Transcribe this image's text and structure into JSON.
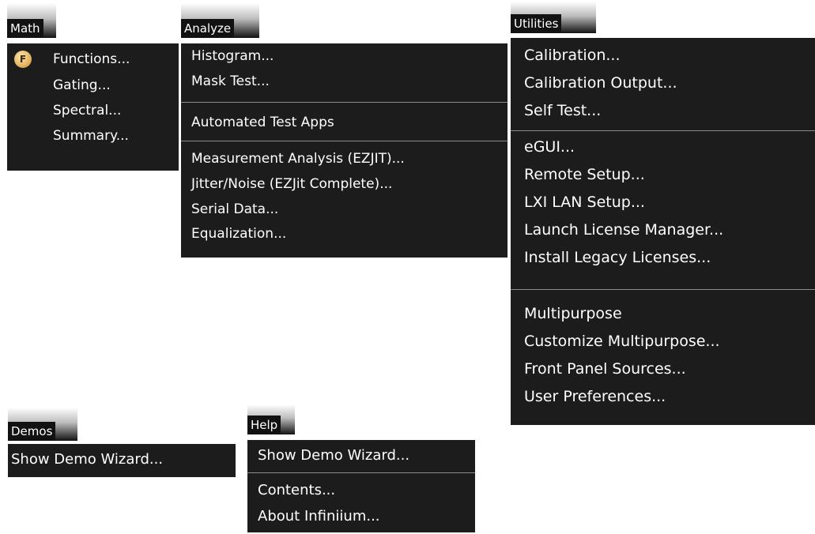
{
  "menus": {
    "math": {
      "title": "Math",
      "items": [
        {
          "label": "Functions...",
          "icon": "functions-f-icon"
        },
        {
          "label": "Gating..."
        },
        {
          "label": "Spectral..."
        },
        {
          "label": "Summary..."
        }
      ]
    },
    "analyze": {
      "title": "Analyze",
      "items": [
        {
          "label": "Histogram..."
        },
        {
          "label": "Mask Test..."
        },
        {
          "label": "Automated Test Apps"
        },
        {
          "label": "Measurement Analysis (EZJIT)..."
        },
        {
          "label": "Jitter/Noise (EZJit Complete)..."
        },
        {
          "label": "Serial Data..."
        },
        {
          "label": "Equalization..."
        }
      ]
    },
    "utilities": {
      "title": "Utilities",
      "items": [
        {
          "label": "Calibration..."
        },
        {
          "label": "Calibration Output..."
        },
        {
          "label": "Self Test..."
        },
        {
          "label": "eGUI..."
        },
        {
          "label": "Remote Setup..."
        },
        {
          "label": "LXI LAN Setup..."
        },
        {
          "label": "Launch License Manager..."
        },
        {
          "label": "Install Legacy Licenses..."
        },
        {
          "label": "Multipurpose"
        },
        {
          "label": "Customize Multipurpose..."
        },
        {
          "label": "Front Panel Sources..."
        },
        {
          "label": "User Preferences..."
        }
      ]
    },
    "demos": {
      "title": "Demos",
      "items": [
        {
          "label": "Show Demo Wizard..."
        }
      ]
    },
    "help": {
      "title": "Help",
      "items": [
        {
          "label": "Show Demo Wizard..."
        },
        {
          "label": "Contents..."
        },
        {
          "label": "About Infiniium..."
        }
      ]
    }
  },
  "colors": {
    "menu_bg": "#1c1c1c",
    "header_bg": "#121212",
    "separator": "#8c8c8c",
    "text": "#ffffff",
    "function_badge": "#e7b865"
  }
}
